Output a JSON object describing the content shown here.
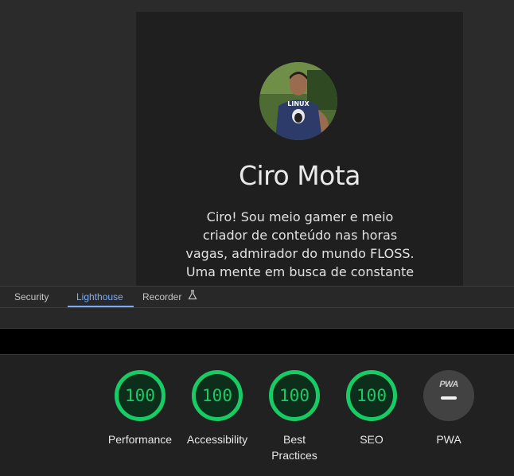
{
  "profile": {
    "name": "Ciro Mota",
    "bio": "Ciro! Sou meio gamer e meio criador de conteúdo nas horas vagas, admirador do mundo FLOSS. Uma mente em busca de constante"
  },
  "devtools": {
    "tabs": [
      {
        "label": "Security",
        "active": false
      },
      {
        "label": "Lighthouse",
        "active": true
      },
      {
        "label": "Recorder",
        "active": false,
        "icon": "flask-icon"
      }
    ]
  },
  "lighthouse": {
    "colors": {
      "pass": "#18cc65",
      "pwa_bg": "#424242"
    },
    "gauges": [
      {
        "label": "Performance",
        "score": "100"
      },
      {
        "label": "Accessibility",
        "score": "100"
      },
      {
        "label": "Best Practices",
        "score": "100"
      },
      {
        "label": "SEO",
        "score": "100"
      }
    ],
    "pwa": {
      "label": "PWA",
      "badge": "PWA"
    }
  }
}
